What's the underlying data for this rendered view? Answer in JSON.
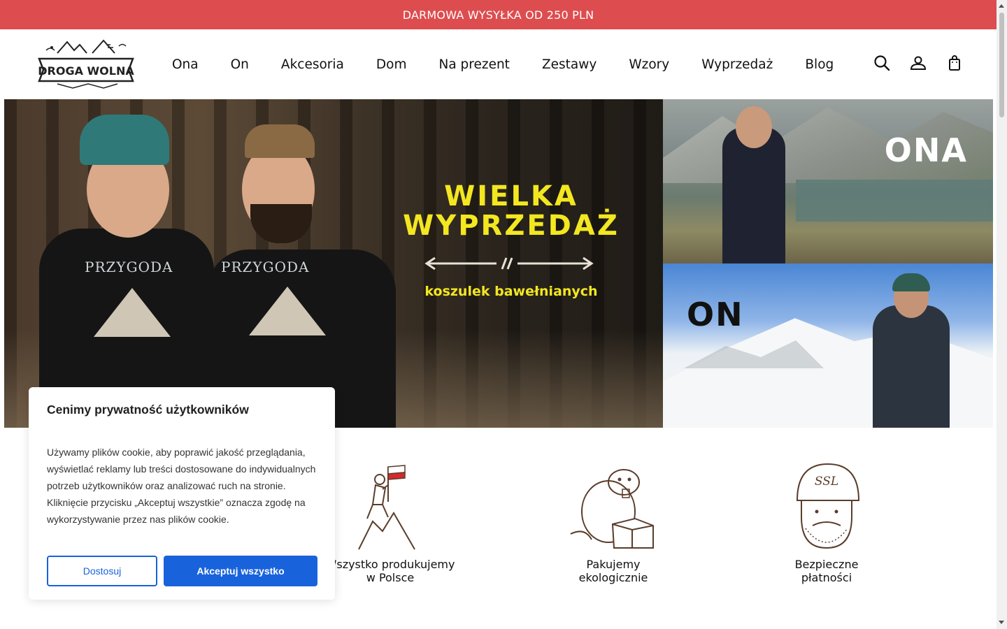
{
  "topbar": {
    "text": "DARMOWA WYSYŁKA OD 250 PLN"
  },
  "header": {
    "logo_text": "DROGA WOLNA",
    "nav": [
      "Ona",
      "On",
      "Akcesoria",
      "Dom",
      "Na prezent",
      "Zestawy",
      "Wzory",
      "Wyprzedaż",
      "Blog"
    ],
    "icons": [
      "search-icon",
      "account-icon",
      "cart-icon"
    ]
  },
  "hero": {
    "title_line1": "WIELKA",
    "title_line2": "WYPRZEDAŻ",
    "subtitle": "koszulek bawełnianych",
    "shirt_print": "PRZYGODA",
    "tile_women": "ONA",
    "tile_men": "ON"
  },
  "features": [
    {
      "label_line1": "Wszystko produkujemy",
      "label_line2": "w Polsce",
      "icon": "climber-flag-icon"
    },
    {
      "label_line1": "Pakujemy",
      "label_line2": "ekologicznie",
      "icon": "beaver-box-icon"
    },
    {
      "label_line1": "Bezpieczne",
      "label_line2": "płatności",
      "icon": "ssl-helmet-icon",
      "helmet_text": "SSL"
    }
  ],
  "cookie": {
    "title": "Cenimy prywatność użytkowników",
    "text": "Używamy plików cookie, aby poprawić jakość przeglądania, wyświetlać reklamy lub treści dostosowane do indywidualnych potrzeb użytkowników oraz analizować ruch na stronie. Kliknięcie przycisku „Akceptuj wszystkie” oznacza zgodę na wykorzystywanie przez nas plików cookie.",
    "customize_label": "Dostosuj",
    "accept_label": "Akceptuj wszystko"
  },
  "colors": {
    "topbar": "#dd4d4f",
    "accent_blue": "#1863dc",
    "sale_yellow": "#f3e720"
  }
}
